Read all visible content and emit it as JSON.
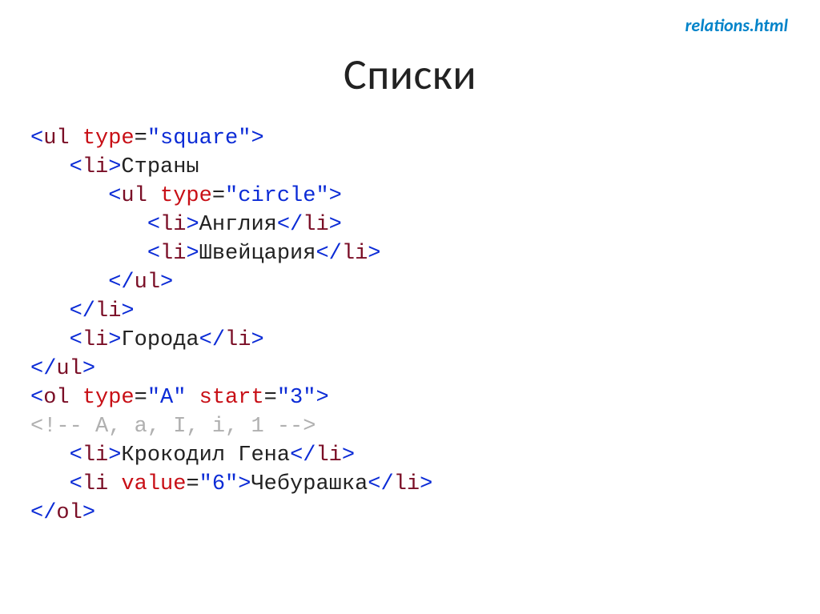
{
  "header": {
    "filelink": "relations.html",
    "title": "Списки"
  },
  "code": {
    "l1": {
      "open": "<",
      "tag": "ul",
      "sp": " ",
      "attr": "type",
      "eq": "=",
      "val": "\"square\"",
      "close": ">"
    },
    "l2": {
      "indent": "   ",
      "open": "<",
      "tag": "li",
      "close": ">",
      "text": "Страны"
    },
    "l3": {
      "indent": "      ",
      "open": "<",
      "tag": "ul",
      "sp": " ",
      "attr": "type",
      "eq": "=",
      "val": "\"circle\"",
      "close": ">"
    },
    "l4": {
      "indent": "         ",
      "open": "<",
      "tag": "li",
      "close1": ">",
      "text": "Англия",
      "open2": "</",
      "tag2": "li",
      "close2": ">"
    },
    "l5": {
      "indent": "         ",
      "open": "<",
      "tag": "li",
      "close1": ">",
      "text": "Швейцария",
      "open2": "</",
      "tag2": "li",
      "close2": ">"
    },
    "l6": {
      "indent": "      ",
      "open": "</",
      "tag": "ul",
      "close": ">"
    },
    "l7": {
      "indent": "   ",
      "open": "</",
      "tag": "li",
      "close": ">"
    },
    "l8": {
      "indent": "   ",
      "open": "<",
      "tag": "li",
      "close1": ">",
      "text": "Города",
      "open2": "</",
      "tag2": "li",
      "close2": ">"
    },
    "l9": {
      "open": "</",
      "tag": "ul",
      "close": ">"
    },
    "l10": {
      "open": "<",
      "tag": "ol",
      "sp": " ",
      "attr1": "type",
      "eq1": "=",
      "val1": "\"A\"",
      "sp2": " ",
      "attr2": "start",
      "eq2": "=",
      "val2": "\"3\"",
      "close": ">"
    },
    "l11": {
      "comment": "<!-- A, a, I, i, 1 -->"
    },
    "l12": {
      "indent": "   ",
      "open": "<",
      "tag": "li",
      "close1": ">",
      "text": "Крокодил Гена",
      "open2": "</",
      "tag2": "li",
      "close2": ">"
    },
    "l13": {
      "indent": "   ",
      "open": "<",
      "tag": "li",
      "sp": " ",
      "attr": "value",
      "eq": "=",
      "val": "\"6\"",
      "close1": ">",
      "text": "Чебурашка",
      "open2": "</",
      "tag2": "li",
      "close2": ">"
    },
    "l14": {
      "open": "</",
      "tag": "ol",
      "close": ">"
    }
  }
}
